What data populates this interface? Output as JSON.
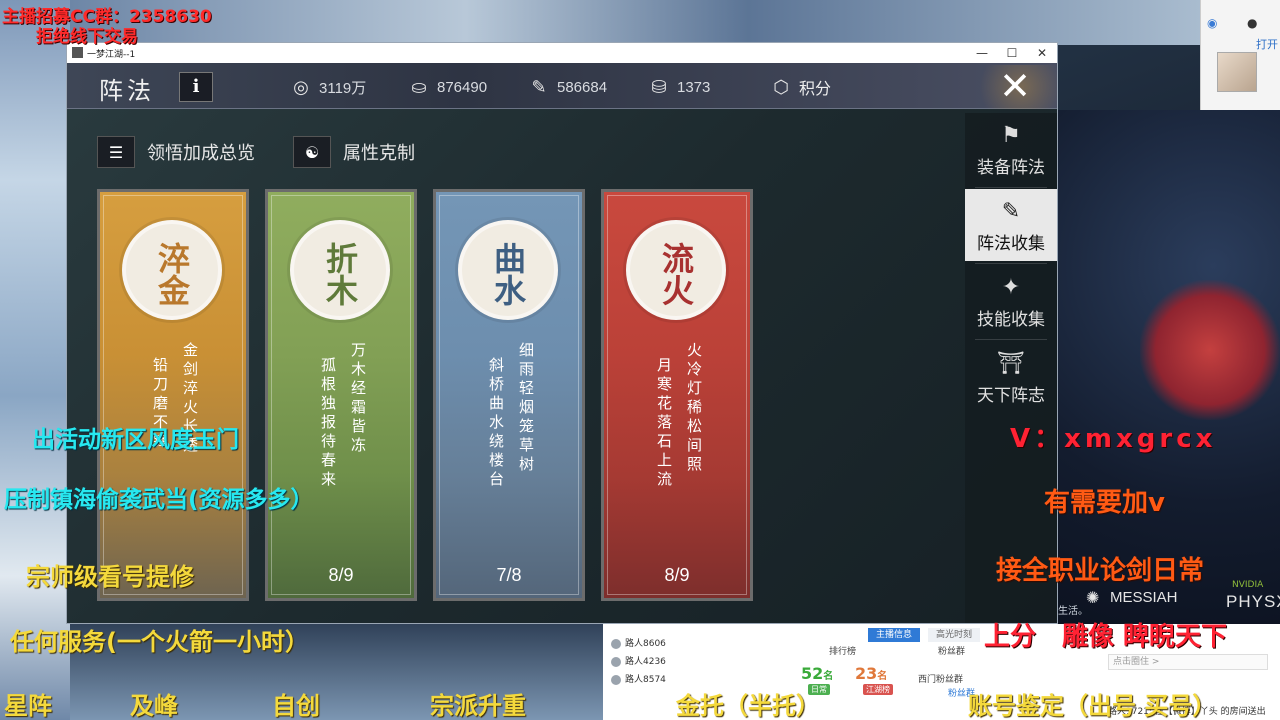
{
  "stream_overlay": {
    "top_line1": "主播招募CC群：2358630",
    "top_line2": "拒绝线下交易",
    "left_line1": "出活动新区风度玉门",
    "left_line2": "压制镇海偷袭武当(资源多多）",
    "left_line3": "宗师级看号提修",
    "left_line4": "任何服务(一个火箭一小时）",
    "bottom_items": [
      "星阵",
      "及峰",
      "自创",
      "宗派升重",
      "金托（半托）",
      "账号鉴定（出号 买号）"
    ],
    "right_line1": "V：xmxgrcx",
    "right_line2": "有需要加v",
    "right_line3": "接全职业论剑日常",
    "right_line4": "上分　雕像 睥睨天下",
    "messiah": "MESSIAH",
    "nvidia": "NVIDIA",
    "physx": "PHYSX",
    "caption": "生活。"
  },
  "cam_panel": {
    "label": "打开"
  },
  "chat_panel": {
    "tabs": [
      "主播信息",
      "高光时刻"
    ],
    "left_header": "排行榜",
    "mid_header": "粉丝群",
    "rows": [
      "路人8606",
      "路人4236",
      "路人8574"
    ],
    "stat1": {
      "value": "52",
      "unit": "名",
      "badge": "日常"
    },
    "stat2": {
      "value": "23",
      "unit": "名",
      "badge": "江湖榜"
    },
    "side_text1": "西门粉丝群",
    "side_text2": "粉丝群",
    "input_placeholder": "点击圈住 >",
    "message": "路人1721: 在【微博】丫头 的房间送出"
  },
  "window": {
    "title": "一梦江湖--1",
    "min": "—",
    "max": "☐",
    "close": "✕"
  },
  "game": {
    "title": "阵法",
    "info_label": "i",
    "resources": [
      {
        "icon": "coin-reel-icon",
        "value": "3119万"
      },
      {
        "icon": "silver-ingot-icon",
        "value": "876490"
      },
      {
        "icon": "ticket-icon",
        "value": "586684"
      },
      {
        "icon": "gold-ingot-icon",
        "value": "1373"
      },
      {
        "icon": "shield-icon",
        "value": "积分"
      }
    ],
    "subnav": [
      {
        "icon": "list-icon",
        "label": "领悟加成总览"
      },
      {
        "icon": "swirl-icon",
        "label": "属性克制"
      }
    ],
    "cards": [
      {
        "name": "淬金",
        "poem_right": "金剑淬火长透",
        "poem_left": "铅刀磨不锋",
        "count": "",
        "color": "#d49a3c"
      },
      {
        "name": "折木",
        "poem_right": "万木经霜皆冻",
        "poem_left": "孤根独报待春来",
        "count": "8/9",
        "color": "#8aa85a"
      },
      {
        "name": "曲水",
        "poem_right": "细雨轻烟笼草树",
        "poem_left": "斜桥曲水绕楼台",
        "count": "7/8",
        "color": "#6d8fb0"
      },
      {
        "name": "流火",
        "poem_right": "火冷灯稀松间照",
        "poem_left": "月寒花落石上流",
        "count": "8/9",
        "color": "#c44a3f"
      }
    ],
    "sidebar": [
      {
        "icon": "equip-formation-icon",
        "label": "装备阵法"
      },
      {
        "icon": "scroll-collection-icon",
        "label": "阵法收集"
      },
      {
        "icon": "skill-flame-icon",
        "label": "技能收集"
      },
      {
        "icon": "pavilion-icon",
        "label": "天下阵志"
      }
    ]
  }
}
